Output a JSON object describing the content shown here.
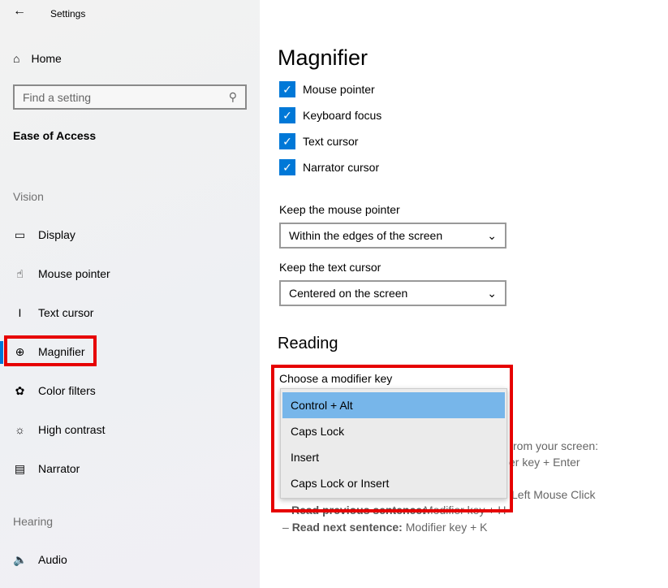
{
  "window": {
    "title": "Settings",
    "back_icon": "back-arrow-icon"
  },
  "sidebar": {
    "home": "Home",
    "search_placeholder": "Find a setting",
    "section": "Ease of Access",
    "groups": {
      "vision": "Vision",
      "hearing": "Hearing"
    },
    "items": [
      {
        "label": "Display",
        "icon": "monitor-icon"
      },
      {
        "label": "Mouse pointer",
        "icon": "pointer-icon"
      },
      {
        "label": "Text cursor",
        "icon": "text-cursor-icon"
      },
      {
        "label": "Magnifier",
        "icon": "magnifier-icon",
        "selected": true
      },
      {
        "label": "Color filters",
        "icon": "palette-icon"
      },
      {
        "label": "High contrast",
        "icon": "contrast-icon"
      },
      {
        "label": "Narrator",
        "icon": "narrator-icon"
      },
      {
        "label": "Audio",
        "icon": "speaker-icon"
      }
    ]
  },
  "main": {
    "title": "Magnifier",
    "checkboxes": [
      {
        "label": "Mouse pointer",
        "checked": true
      },
      {
        "label": "Keyboard focus",
        "checked": true
      },
      {
        "label": "Text cursor",
        "checked": true
      },
      {
        "label": "Narrator cursor",
        "checked": true
      }
    ],
    "keep_mouse": {
      "label": "Keep the mouse pointer",
      "value": "Within the edges of the screen"
    },
    "keep_text": {
      "label": "Keep the text cursor",
      "value": "Centered on the screen"
    },
    "reading": {
      "title": "Reading",
      "modifier_label": "Choose a modifier key",
      "options": [
        "Control + Alt",
        "Caps Lock",
        "Insert",
        "Caps Lock or Insert"
      ],
      "highlighted": "Control + Alt",
      "background_fragments": [
        "rom your screen:",
        "er key + Enter",
        "Left Mouse Click",
        "Read previous sentence:",
        "Modifier key + H"
      ],
      "next_sentence": {
        "label": "Read next sentence:",
        "value": "Modifier key + K"
      }
    }
  },
  "colors": {
    "accent": "#0078d7",
    "highlight": "#77b6ea",
    "annotation": "#e60000"
  }
}
